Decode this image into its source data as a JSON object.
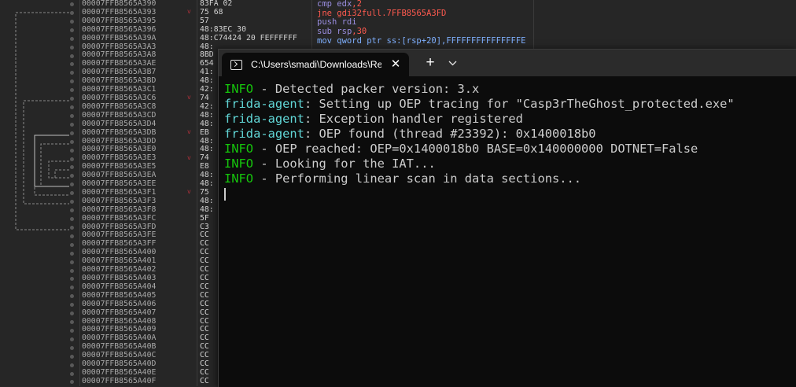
{
  "debugger": {
    "addresses": [
      "00007FFB8565A390",
      "00007FFB8565A393",
      "00007FFB8565A395",
      "00007FFB8565A396",
      "00007FFB8565A39A",
      "00007FFB8565A3A3",
      "00007FFB8565A3A8",
      "00007FFB8565A3AE",
      "00007FFB8565A3B7",
      "00007FFB8565A3BD",
      "00007FFB8565A3C1",
      "00007FFB8565A3C6",
      "00007FFB8565A3C8",
      "00007FFB8565A3CD",
      "00007FFB8565A3D4",
      "00007FFB8565A3DB",
      "00007FFB8565A3DD",
      "00007FFB8565A3E0",
      "00007FFB8565A3E3",
      "00007FFB8565A3E5",
      "00007FFB8565A3EA",
      "00007FFB8565A3EE",
      "00007FFB8565A3F1",
      "00007FFB8565A3F3",
      "00007FFB8565A3F8",
      "00007FFB8565A3FC",
      "00007FFB8565A3FD",
      "00007FFB8565A3FE",
      "00007FFB8565A3FF",
      "00007FFB8565A400",
      "00007FFB8565A401",
      "00007FFB8565A402",
      "00007FFB8565A403",
      "00007FFB8565A404",
      "00007FFB8565A405",
      "00007FFB8565A406",
      "00007FFB8565A407",
      "00007FFB8565A408",
      "00007FFB8565A409",
      "00007FFB8565A40A",
      "00007FFB8565A40B",
      "00007FFB8565A40C",
      "00007FFB8565A40D",
      "00007FFB8565A40E",
      "00007FFB8565A40F"
    ],
    "bytes": [
      "83FA 02",
      "75 68",
      "57",
      "48:83EC 30",
      "48:C74424 20 FEFFFFFF",
      "48:",
      "8BD",
      "654",
      "41:",
      "48:",
      "42:",
      "74",
      "42:",
      "48:",
      "48:",
      "EB",
      "48:",
      "48:",
      "74",
      "E8",
      "48:",
      "48:",
      "75",
      "48:",
      "48:",
      "5F",
      "C3",
      "CC",
      "CC",
      "CC",
      "CC",
      "CC",
      "CC",
      "CC",
      "CC",
      "CC",
      "CC",
      "CC",
      "CC",
      "CC",
      "CC",
      "CC",
      "CC",
      "CC",
      "CC"
    ],
    "jump_marks": [
      "",
      "v",
      "",
      "",
      "",
      "",
      "",
      "",
      "",
      "",
      "",
      "v",
      "",
      "",
      "",
      "v",
      "",
      "",
      "v",
      "",
      "",
      "",
      "v",
      "",
      "",
      "",
      "",
      "",
      "",
      "",
      "",
      "",
      "",
      "",
      "",
      "",
      "",
      "",
      "",
      "",
      "",
      "",
      "",
      "",
      ""
    ],
    "disasm": [
      {
        "parts": [
          {
            "t": "cmp ",
            "c": "kw"
          },
          {
            "t": "edx",
            "c": "kw"
          },
          {
            "t": ",2",
            "c": "red"
          }
        ]
      },
      {
        "parts": [
          {
            "t": "jne ",
            "c": "red"
          },
          {
            "t": "gdi32full.7FFB8565A3FD",
            "c": "red"
          }
        ]
      },
      {
        "parts": [
          {
            "t": "push ",
            "c": "kw"
          },
          {
            "t": "rdi",
            "c": "kw"
          }
        ]
      },
      {
        "parts": [
          {
            "t": "sub ",
            "c": "kw"
          },
          {
            "t": "rsp",
            "c": "kw"
          },
          {
            "t": ",30",
            "c": "red"
          }
        ]
      },
      {
        "parts": [
          {
            "t": "mov qword ptr ss:[rsp+20],FFFFFFFFFFFFFFFE",
            "c": "blue"
          }
        ]
      }
    ]
  },
  "terminal": {
    "tab_title": "C:\\Users\\smadi\\Downloads\\Re",
    "close_glyph": "✕",
    "new_tab_glyph": "+",
    "lines": [
      {
        "prefix": "INFO",
        "prefix_color": "green",
        "text": " - Detected packer version: 3.x"
      },
      {
        "prefix": "frida-agent",
        "prefix_color": "cyan",
        "text": ": Setting up OEP tracing for \"Casp3rTheGhost_protected.exe\""
      },
      {
        "prefix": "frida-agent",
        "prefix_color": "cyan",
        "text": ": Exception handler registered"
      },
      {
        "prefix": "frida-agent",
        "prefix_color": "cyan",
        "text": ": OEP found (thread #23392): 0x1400018b0"
      },
      {
        "prefix": "INFO",
        "prefix_color": "green",
        "text": " - OEP reached: OEP=0x1400018b0 BASE=0x140000000 DOTNET=False"
      },
      {
        "prefix": "INFO",
        "prefix_color": "green",
        "text": " - Looking for the IAT..."
      },
      {
        "prefix": "INFO",
        "prefix_color": "green",
        "text": " - Performing linear scan in data sections..."
      }
    ]
  }
}
